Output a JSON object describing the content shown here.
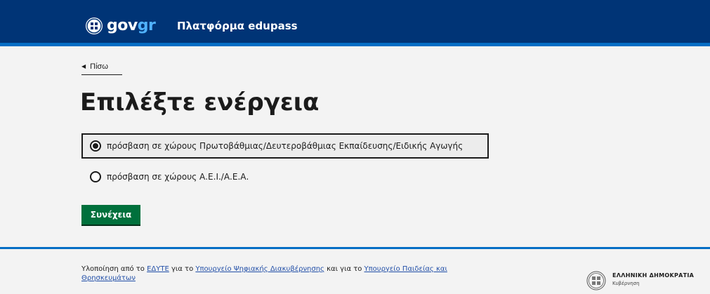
{
  "header": {
    "logo_prefix": "gov",
    "logo_suffix": "gr",
    "platform_title": "Πλατφόρμα edupass"
  },
  "back": {
    "label": "Πίσω",
    "icon": "triangle-left-icon"
  },
  "page_title": "Επιλέξτε ενέργεια",
  "options": [
    {
      "label": "πρόσβαση σε χώρους Πρωτοβάθμιας/Δευτεροβάθμιας Εκπαίδευσης/Ειδικής Αγωγής",
      "selected": true
    },
    {
      "label": "πρόσβαση σε χώρους Α.Ε.Ι./Α.Ε.Α.",
      "selected": false
    }
  ],
  "continue_button": "Συνέχεια",
  "footer": {
    "text_1": "Υλοποίηση από το ",
    "link_1": "ΕΔΥΤΕ",
    "text_2": " για το ",
    "link_2": "Υπουργείο Ψηφιακής Διακυβέρνησης",
    "text_3": " και για το ",
    "link_3": "Υπουργείο Παιδείας και Θρησκευμάτων",
    "gov_name": "ΕΛΛΗΝΙΚΗ ΔΗΜΟΚΡΑΤΙΑ",
    "gov_sub": "Κυβέρνηση"
  },
  "colors": {
    "header_bg": "#003476",
    "accent_blue": "#046ec5",
    "button_green": "#00703c",
    "link": "#2350a8"
  }
}
